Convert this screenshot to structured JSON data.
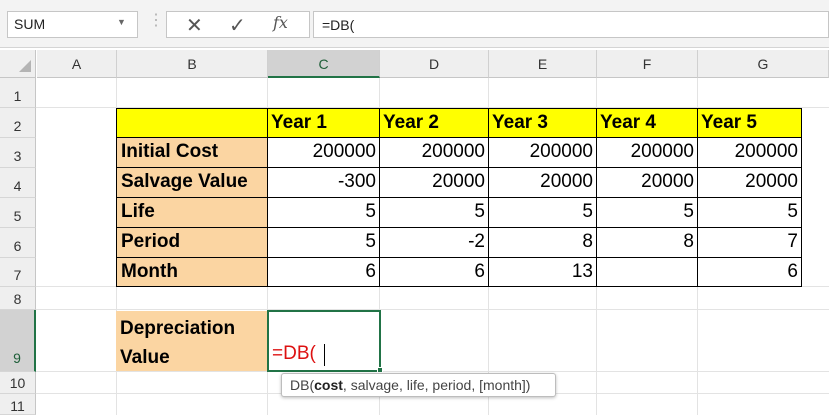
{
  "formula_bar": {
    "name_box": "SUM",
    "cancel_icon": "x-icon",
    "enter_icon": "check-icon",
    "function_icon": "fx",
    "formula": "=DB("
  },
  "columns": [
    "A",
    "B",
    "C",
    "D",
    "E",
    "F",
    "G"
  ],
  "rows": [
    "1",
    "2",
    "3",
    "4",
    "5",
    "6",
    "7",
    "8",
    "9",
    "10",
    "11"
  ],
  "table": {
    "year_headers": [
      "Year 1",
      "Year 2",
      "Year 3",
      "Year 4",
      "Year 5"
    ],
    "rows": [
      {
        "label": "Initial Cost",
        "values": [
          "200000",
          "200000",
          "200000",
          "200000",
          "200000"
        ]
      },
      {
        "label": "Salvage Value",
        "values": [
          "-300",
          "20000",
          "20000",
          "20000",
          "20000"
        ]
      },
      {
        "label": "Life",
        "values": [
          "5",
          "5",
          "5",
          "5",
          "5"
        ]
      },
      {
        "label": "Period",
        "values": [
          "5",
          "-2",
          "8",
          "8",
          "7"
        ]
      },
      {
        "label": "Month",
        "values": [
          "6",
          "6",
          "13",
          "",
          "6"
        ]
      }
    ]
  },
  "depreciation": {
    "label_line1": "Depreciation",
    "label_line2": "Value",
    "cell_text": "=DB("
  },
  "tooltip": {
    "fn": "DB(",
    "bold_arg": "cost",
    "rest": ", salvage, life, period, [month])"
  },
  "colors": {
    "header_fill": "#ffff00",
    "label_fill": "#fbd5a2",
    "selection": "#217346",
    "formula_text": "#dd1111"
  }
}
